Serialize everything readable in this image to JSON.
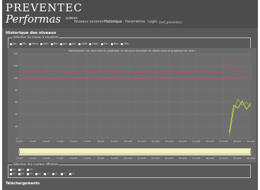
{
  "header": {
    "brand_line1": "PREVENTEC",
    "brand_line2": "Performas",
    "brand_sub": "systems",
    "nav": [
      {
        "label": "Niveaux sonores",
        "active": false
      },
      {
        "label": "Historique",
        "active": true
      },
      {
        "label": "Paramètres",
        "active": false
      },
      {
        "label": "Login",
        "active": false
      },
      {
        "label": "(Inst_preventec)",
        "active": false
      }
    ]
  },
  "history": {
    "title": "Historique des niveaux",
    "level_selection": {
      "legend": "Sélection du niveau à visualiser",
      "options": [
        "Jan.",
        "Fév.",
        "Mars",
        "Avril",
        "Mai",
        "Juin",
        "Juil.",
        "Août",
        "Sept.",
        "Oct.",
        "Nov.",
        "Déc."
      ]
    },
    "chart_instructions": "Sélectionnez une zone dans le graphique du bas pour visualiser en détails dans le graphique du haut !",
    "series_selection": {
      "legend": "Sélection des courbes affichées",
      "row1": [
        {
          "label": "L1",
          "color": "#ffffff"
        },
        {
          "label": "L2",
          "color": "#ffffff"
        },
        {
          "label": "L3",
          "color": "#ffffff"
        }
      ],
      "row2": [
        {
          "label": "L1",
          "color": "#ffffff"
        },
        {
          "label": "L2",
          "color": "#ffffff"
        },
        {
          "label": "L3",
          "color": "#ffffff"
        },
        {
          "label": "L4",
          "color": "#ffffff"
        },
        {
          "label": "L5",
          "color": "#8fd14f"
        },
        {
          "label": "L6",
          "color": "#8fd14f"
        },
        {
          "label": "L7",
          "color": "#8fd14f"
        },
        {
          "label": "L8",
          "color": "#8fd14f"
        }
      ]
    }
  },
  "downloads": {
    "title": "Téléchargements"
  },
  "colors": {
    "panel_bg": "#595959",
    "header_bg": "#4c4c4c",
    "chart_bg": "#6a6a6a",
    "series_magenta": "#d0417e",
    "series_purple": "#9b4fa0",
    "series_green": "#9acd32",
    "series_yellow": "#e6e64c",
    "navigator_bg": "#f3f0c2"
  },
  "chart_data": {
    "type": "line",
    "ylim": [
      0,
      140
    ],
    "y_ticks": [
      "140",
      "120",
      "100",
      "80",
      "60",
      "40",
      "20",
      "0"
    ],
    "x_ticks": [
      "2 août",
      "3 août",
      "4 août",
      "5 août",
      "6 août",
      "7 août",
      "8 août",
      "9 août",
      "10 août",
      "11 août",
      "12 août",
      "13 août",
      "14 août",
      "15 août",
      "16 août",
      "17 août",
      "18 août",
      "19 août"
    ],
    "series": [
      {
        "color": "#d0417e",
        "values": [
          110,
          108,
          112,
          109,
          111,
          107,
          110,
          113,
          106,
          109,
          112,
          108,
          111,
          110,
          109,
          112,
          108,
          110,
          107,
          111,
          109,
          113,
          108,
          110,
          112,
          109,
          111,
          108,
          110,
          109,
          112,
          110,
          108,
          111,
          109,
          110,
          112,
          108,
          111,
          109,
          110,
          113,
          108,
          111,
          109,
          112,
          110,
          108,
          111,
          128,
          115,
          110,
          112,
          109,
          111
        ]
      },
      {
        "color": "#d0417e",
        "values": [
          98,
          99,
          98,
          100,
          99,
          98,
          99,
          100,
          98,
          99,
          98,
          99,
          100,
          98,
          99,
          98,
          99,
          100,
          99,
          98,
          99,
          98,
          100,
          99,
          98,
          99,
          100,
          98,
          99,
          98,
          99,
          100,
          99,
          98,
          99,
          98,
          100,
          99,
          98,
          99,
          100,
          98,
          99,
          98,
          99,
          100,
          99,
          98,
          99,
          98,
          100,
          99,
          98,
          99,
          98
        ]
      },
      {
        "color": "#9b4fa0",
        "values": [
          92,
          92,
          92,
          92,
          92,
          92,
          92,
          92,
          92,
          92,
          92,
          92,
          92,
          92,
          92,
          92,
          92,
          92,
          92,
          92,
          92,
          92,
          92,
          92,
          92,
          92,
          92,
          92,
          92,
          92,
          92,
          92,
          92,
          92,
          92,
          92,
          92,
          92,
          92,
          92,
          92,
          92,
          92,
          92,
          92,
          92,
          92,
          92,
          92,
          92,
          92,
          92,
          92,
          92,
          92
        ]
      },
      {
        "color": "#9acd32",
        "values": [
          null,
          null,
          null,
          null,
          null,
          null,
          null,
          null,
          null,
          null,
          null,
          null,
          null,
          null,
          null,
          null,
          null,
          null,
          null,
          null,
          null,
          null,
          null,
          null,
          null,
          null,
          null,
          null,
          null,
          null,
          null,
          null,
          null,
          null,
          null,
          null,
          null,
          null,
          null,
          null,
          null,
          null,
          null,
          null,
          null,
          null,
          null,
          null,
          null,
          5,
          45,
          65,
          55,
          60,
          52
        ]
      },
      {
        "color": "#e6e64c",
        "values": [
          null,
          null,
          null,
          null,
          null,
          null,
          null,
          null,
          null,
          null,
          null,
          null,
          null,
          null,
          null,
          null,
          null,
          null,
          null,
          null,
          null,
          null,
          null,
          null,
          null,
          null,
          null,
          null,
          null,
          null,
          null,
          null,
          null,
          null,
          null,
          null,
          null,
          null,
          null,
          null,
          null,
          null,
          null,
          null,
          null,
          null,
          null,
          null,
          null,
          10,
          55,
          50,
          62,
          48,
          58
        ]
      }
    ]
  }
}
